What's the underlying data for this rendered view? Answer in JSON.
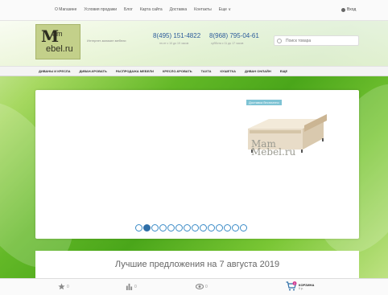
{
  "top_nav": {
    "links": [
      "О Магазине",
      "Условия продажи",
      "Блог",
      "Карта сайта",
      "Доставка",
      "Контакты",
      "Еще ∨"
    ],
    "login": "Вход"
  },
  "header": {
    "logo": {
      "m": "M",
      "line1": "am",
      "line2": "ebel.ru"
    },
    "tagline": "Интернет-магазин мебели",
    "phone1": "8(495) 151-4822",
    "phone1_hours": "пн-пт с 10 до 19 часов",
    "phone2": "8(968) 795-04-61",
    "phone2_hours": "суббота с 11 до 17 часов",
    "search_placeholder": "Поиск товара"
  },
  "categories": [
    "ДИВАНЫ И КРЕСЛА",
    "ДИВАН-КРОВАТЬ",
    "РАСПРОДАЖА МЕБЕЛИ",
    "КРЕСЛО-КРОВАТЬ",
    "ТАХТА",
    "КУШЕТКА",
    "ДИВАН ОНЛАЙН",
    "ЕЩЕ"
  ],
  "slider": {
    "badge": "Доставка бесплатно",
    "watermark": {
      "line1": "Mam",
      "line2": "Mebel.ru"
    },
    "slide_count": 14,
    "active_index": 1
  },
  "offers_title": "Лучшие предложения на 7 августа 2019",
  "bottom_bar": {
    "favorites_count": "0",
    "compare_count": "0",
    "viewed_count": "0",
    "cart_label": "КОРЗИНА",
    "cart_price": "0 р.",
    "cart_count": "0"
  },
  "colors": {
    "accent": "#2f6fa8",
    "phone": "#2a5a9a",
    "logo_bg": "#c3d08a",
    "cart": "#d0308a"
  }
}
